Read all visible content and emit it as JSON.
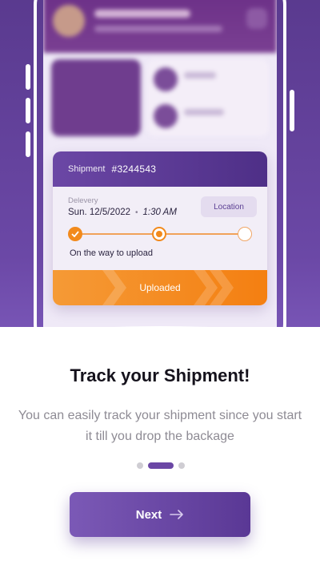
{
  "shipment_card": {
    "shipment_label": "Shipment",
    "shipment_number": "#3244543",
    "delivery_label": "Delevery",
    "delivery_date": "Sun. 12/5/2022",
    "delivery_time": "1:30 AM",
    "location_button": "Location",
    "current_stage": "On the way to upload",
    "status_bar": "Uploaded",
    "steps_total": 3,
    "steps_completed": 1
  },
  "onboarding": {
    "title": "Track your Shipment!",
    "subtitle": "You can easily track your shipment since you start it till you drop the backage",
    "page_indicator": {
      "total": 3,
      "active_index": 1
    },
    "next_button": "Next"
  },
  "colors": {
    "brand_purple": "#6b47a5",
    "accent_orange": "#f28a1c",
    "background": "#5a3a8f"
  },
  "icons": {
    "step_done": "check-icon",
    "next_arrow": "arrow-right-icon"
  }
}
